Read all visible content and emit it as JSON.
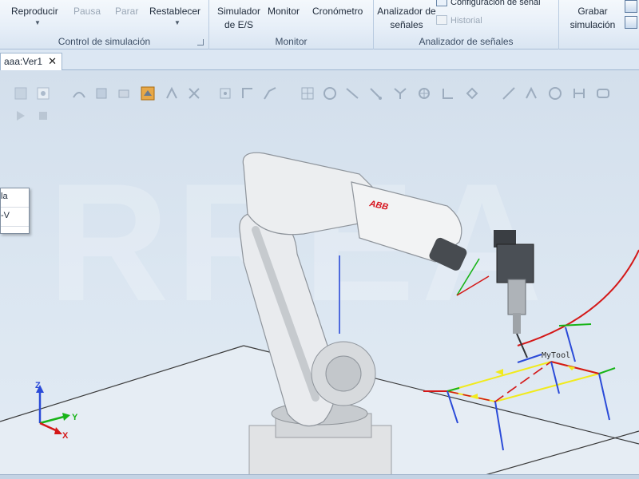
{
  "ribbon": {
    "simulation_control": {
      "title": "Control de simulación",
      "play_label": "Reproducir",
      "pause_label": "Pausa",
      "stop_label": "Parar",
      "reset_label": "Restablecer"
    },
    "monitor": {
      "title": "Monitor",
      "io_simulator_label": "Simulador de E/S",
      "monitor_label": "Monitor",
      "stopwatch_label": "Cronómetro"
    },
    "signal_analyzer": {
      "title": "Analizador de señales",
      "analyzer_label": "Analizador de señales",
      "config_label": "Configuración de señal",
      "history_label": "Historial"
    },
    "recording": {
      "record_label": "Grabar simulación"
    }
  },
  "tabs": [
    {
      "label": "aaa:Ver1",
      "close": "✕"
    }
  ],
  "viewport": {
    "watermark": "RREA",
    "context_menu": [
      "la",
      "-V"
    ],
    "tool_label": "MyTool",
    "brand": "ABB",
    "axes": {
      "x": "X",
      "y": "Y",
      "z": "Z"
    }
  }
}
